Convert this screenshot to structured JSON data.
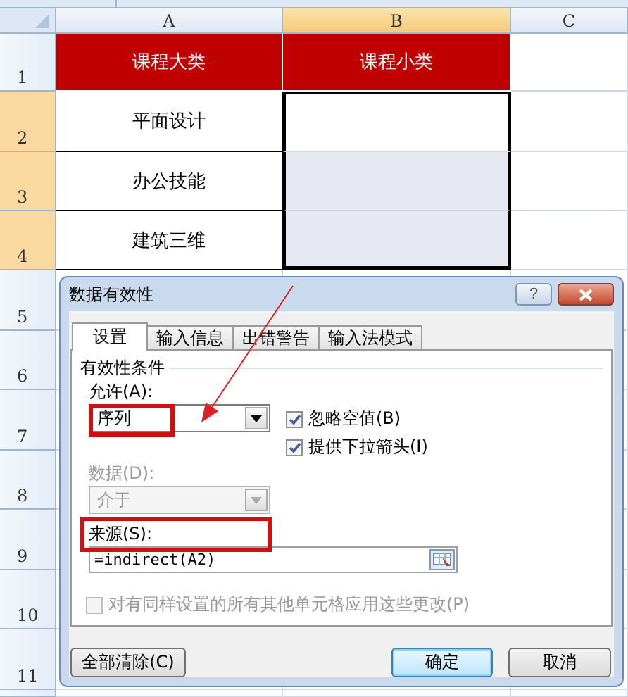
{
  "sheet": {
    "columns": [
      {
        "label": "A",
        "selected": false
      },
      {
        "label": "B",
        "selected": true
      },
      {
        "label": "C",
        "selected": false
      }
    ],
    "rows": [
      {
        "label": "1",
        "selected": false
      },
      {
        "label": "2",
        "selected": true
      },
      {
        "label": "3",
        "selected": true
      },
      {
        "label": "4",
        "selected": true
      },
      {
        "label": "5",
        "selected": false
      },
      {
        "label": "6",
        "selected": false
      },
      {
        "label": "7",
        "selected": false
      },
      {
        "label": "8",
        "selected": false
      },
      {
        "label": "9",
        "selected": false
      },
      {
        "label": "10",
        "selected": false
      },
      {
        "label": "11",
        "selected": false
      }
    ],
    "header_cells": [
      "课程大类",
      "课程小类"
    ],
    "category_cells": [
      "平面设计",
      "办公技能",
      "建筑三维"
    ]
  },
  "dialog": {
    "title": "数据有效性",
    "help": "?",
    "tabs": [
      {
        "label": "设置",
        "selected": true
      },
      {
        "label": "输入信息",
        "selected": false
      },
      {
        "label": "出错警告",
        "selected": false
      },
      {
        "label": "输入法模式",
        "selected": false
      }
    ],
    "group_title": "有效性条件",
    "allow": {
      "label": "允许(A):",
      "value": "序列"
    },
    "data": {
      "label": "数据(D):",
      "value": "介于",
      "disabled": true
    },
    "options": [
      {
        "label": "忽略空值(B)",
        "checked": true
      },
      {
        "label": "提供下拉箭头(I)",
        "checked": true
      }
    ],
    "source": {
      "label": "来源(S):",
      "value": "=indirect(A2)"
    },
    "apply_all": {
      "label": "对有同样设置的所有其他单元格应用这些更改(P)",
      "checked": false,
      "disabled": true
    },
    "buttons": [
      {
        "label": "全部清除(C)",
        "default": false
      },
      {
        "label": "确定",
        "default": true
      },
      {
        "label": "取消",
        "default": false
      }
    ]
  }
}
